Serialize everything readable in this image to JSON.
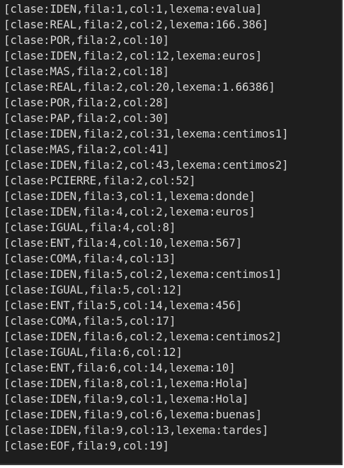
{
  "terminal": {
    "lines": [
      "[clase:IDEN,fila:1,col:1,lexema:evalua]",
      "[clase:REAL,fila:2,col:2,lexema:166.386]",
      "[clase:POR,fila:2,col:10]",
      "[clase:IDEN,fila:2,col:12,lexema:euros]",
      "[clase:MAS,fila:2,col:18]",
      "[clase:REAL,fila:2,col:20,lexema:1.66386]",
      "[clase:POR,fila:2,col:28]",
      "[clase:PAP,fila:2,col:30]",
      "[clase:IDEN,fila:2,col:31,lexema:centimos1]",
      "[clase:MAS,fila:2,col:41]",
      "[clase:IDEN,fila:2,col:43,lexema:centimos2]",
      "[clase:PCIERRE,fila:2,col:52]",
      "[clase:IDEN,fila:3,col:1,lexema:donde]",
      "[clase:IDEN,fila:4,col:2,lexema:euros]",
      "[clase:IGUAL,fila:4,col:8]",
      "[clase:ENT,fila:4,col:10,lexema:567]",
      "[clase:COMA,fila:4,col:13]",
      "[clase:IDEN,fila:5,col:2,lexema:centimos1]",
      "[clase:IGUAL,fila:5,col:12]",
      "[clase:ENT,fila:5,col:14,lexema:456]",
      "[clase:COMA,fila:5,col:17]",
      "[clase:IDEN,fila:6,col:2,lexema:centimos2]",
      "[clase:IGUAL,fila:6,col:12]",
      "[clase:ENT,fila:6,col:14,lexema:10]",
      "[clase:IDEN,fila:8,col:1,lexema:Hola]",
      "[clase:IDEN,fila:9,col:1,lexema:Hola]",
      "[clase:IDEN,fila:9,col:6,lexema:buenas]",
      "[clase:IDEN,fila:9,col:13,lexema:tardes]",
      "[clase:EOF,fila:9,col:19]"
    ]
  },
  "colors": {
    "background": "#1e1e1e",
    "text": "#d6d6d6"
  }
}
